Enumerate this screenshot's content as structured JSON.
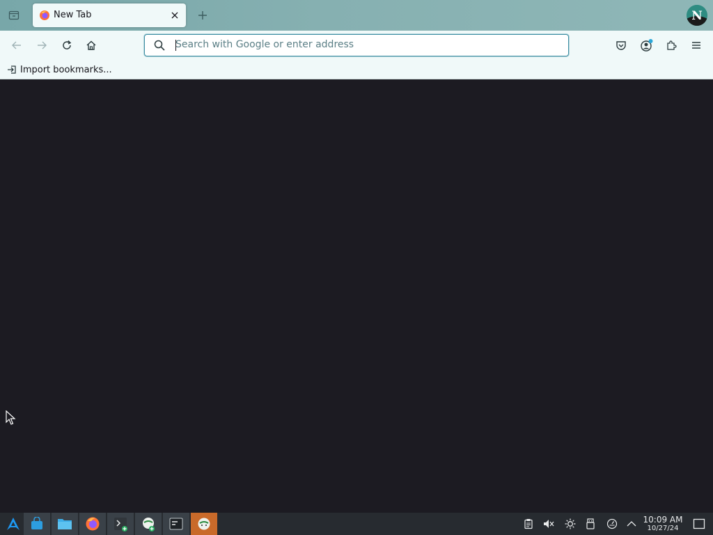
{
  "browser": {
    "tab": {
      "title": "New Tab"
    },
    "urlbar": {
      "placeholder": "Search with Google or enter address",
      "value": ""
    },
    "bookmarks_bar": {
      "import_label": "Import bookmarks..."
    },
    "toolbar_icons": [
      "back-icon",
      "forward-icon",
      "reload-icon",
      "home-icon",
      "pocket-icon",
      "account-icon",
      "extensions-icon",
      "menu-icon"
    ],
    "colors": {
      "chrome": "#f0f9f9",
      "tabstrip": "#86b0b1",
      "content": "#1c1b22",
      "accent": "#3f8fa3"
    }
  },
  "taskbar": {
    "apps": [
      "app-launcher-icon",
      "store-icon",
      "file-manager-icon",
      "firefox-icon",
      "terminal-icon",
      "cat-app-icon",
      "window-manager-icon",
      "cat-app-active-icon"
    ],
    "tray": [
      "clipboard-icon",
      "volume-muted-icon",
      "brightness-icon",
      "usb-icon",
      "updates-icon",
      "tray-expand-icon",
      "show-desktop-icon"
    ],
    "clock": {
      "time": "10:09 AM",
      "date": "10/27/24"
    },
    "colors": {
      "background": "#272b30",
      "active": "#c96a2a"
    }
  }
}
